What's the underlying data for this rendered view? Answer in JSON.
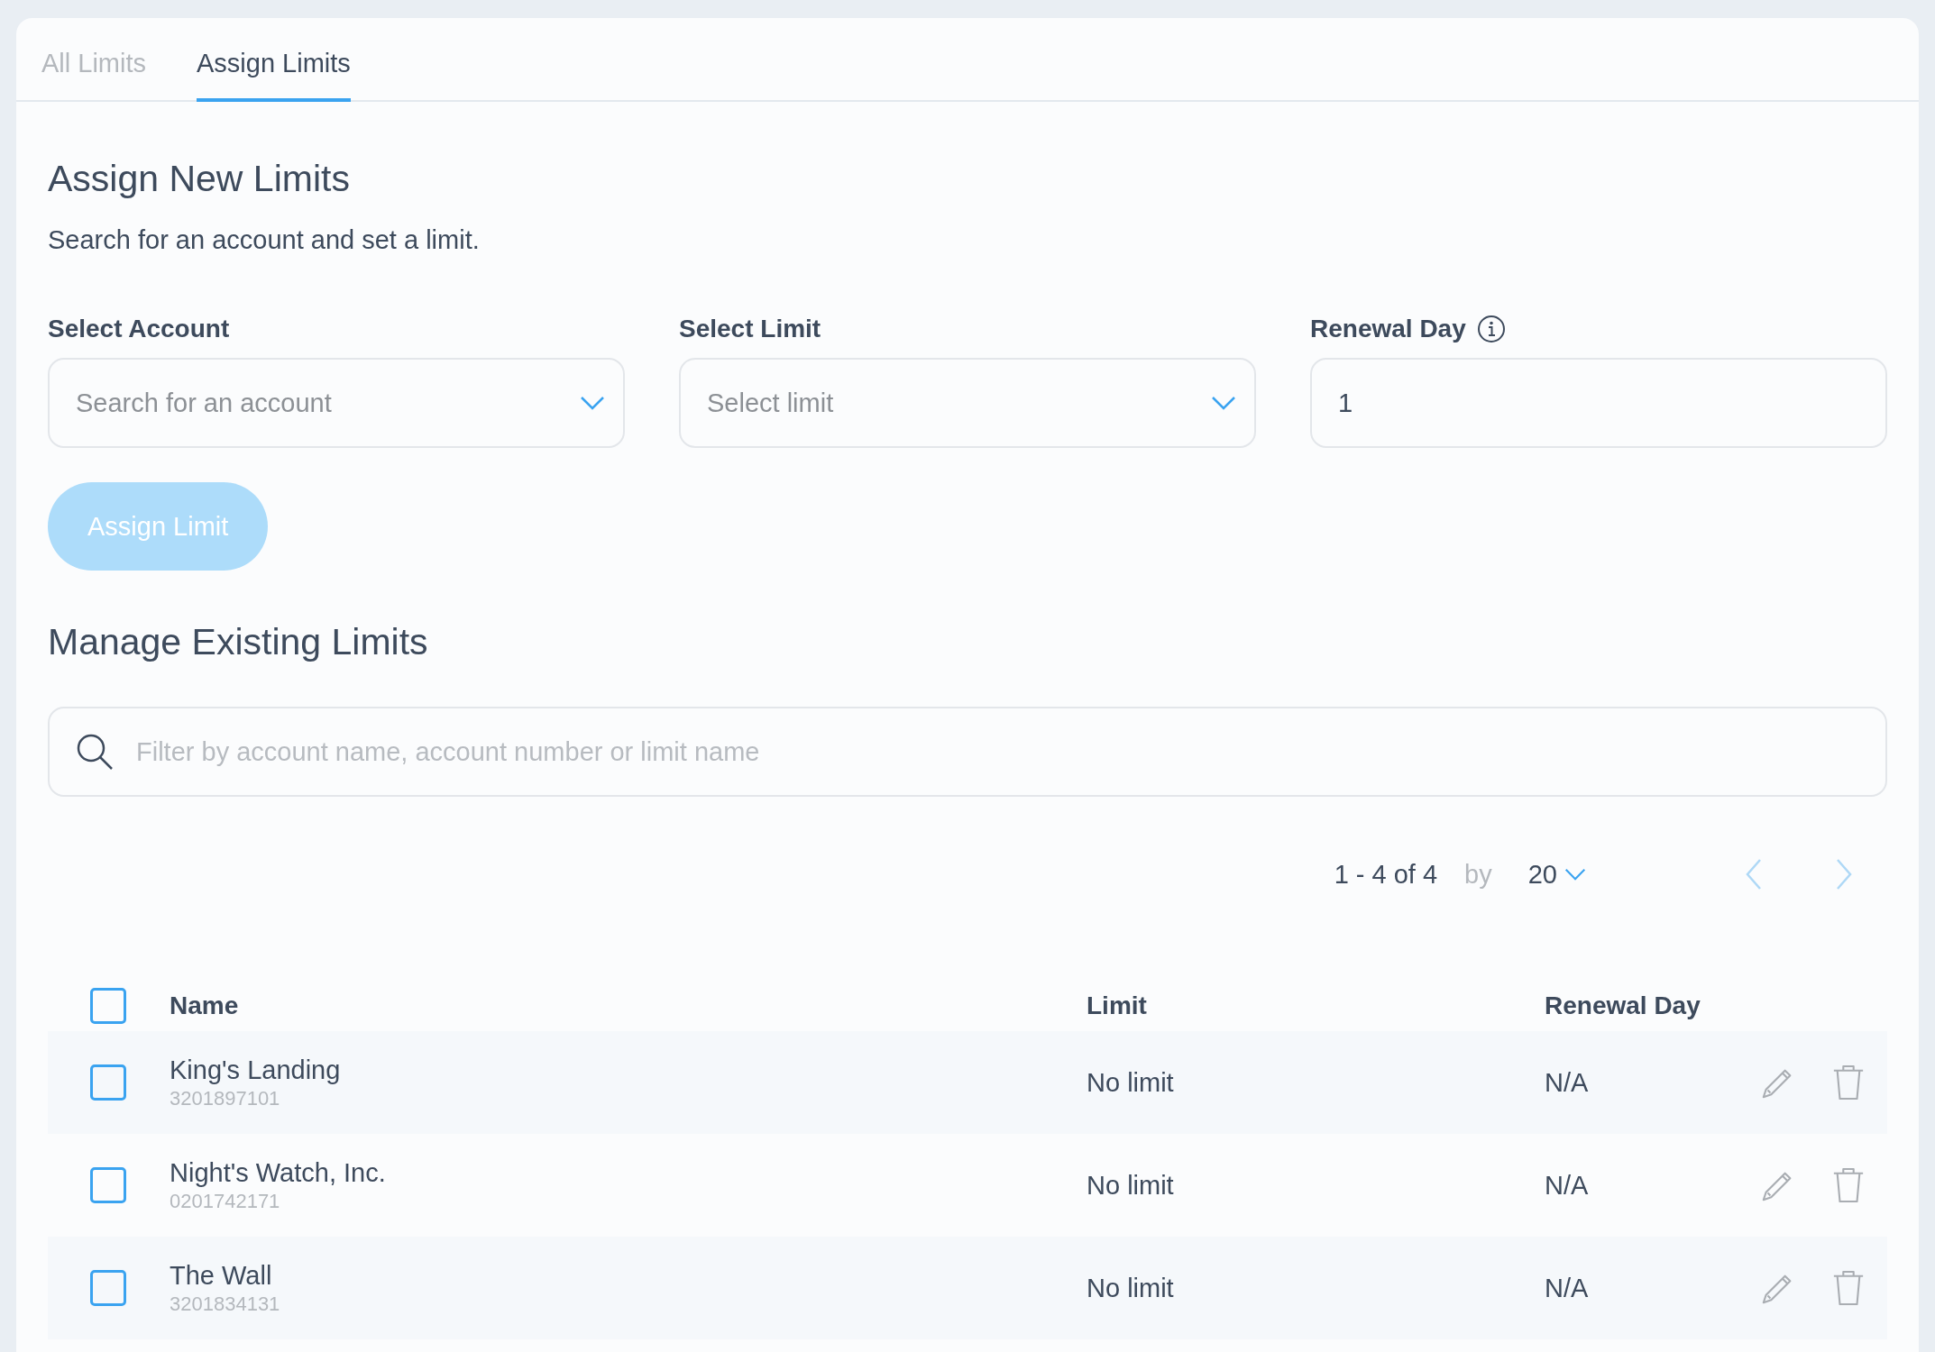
{
  "tabs": [
    {
      "label": "All Limits",
      "selected": false
    },
    {
      "label": "Assign Limits",
      "selected": true
    }
  ],
  "assign": {
    "title": "Assign New Limits",
    "subtitle": "Search for an account and set a limit.",
    "fields": [
      {
        "kind": "dropdown",
        "label": "Select Account",
        "placeholder": "Search for an account"
      },
      {
        "kind": "dropdown",
        "label": "Select Limit",
        "placeholder": "Select limit"
      },
      {
        "kind": "input",
        "label": "Renewal Day",
        "value": "1",
        "info": true
      }
    ],
    "button": {
      "label": "Assign Limit",
      "disabled": true
    }
  },
  "manage": {
    "title": "Manage Existing Limits",
    "search": {
      "placeholder": "Filter by account name, account number or limit name"
    },
    "pagination": {
      "range": "1 - 4 of 4",
      "by": "by",
      "page_size": "20",
      "prev_disabled": true,
      "next_disabled": true
    },
    "table": {
      "select_all": {
        "checked": false
      },
      "columns": [
        "Name",
        "Limit",
        "Renewal Day"
      ],
      "rows": [
        {
          "name": "King's Landing",
          "number": "3201897101",
          "limit": "No limit",
          "renewal_day": "N/A",
          "checked": false
        },
        {
          "name": "Night's Watch, Inc.",
          "number": "0201742171",
          "limit": "No limit",
          "renewal_day": "N/A",
          "checked": false
        },
        {
          "name": "The Wall",
          "number": "3201834131",
          "limit": "No limit",
          "renewal_day": "N/A",
          "checked": false
        }
      ]
    }
  }
}
